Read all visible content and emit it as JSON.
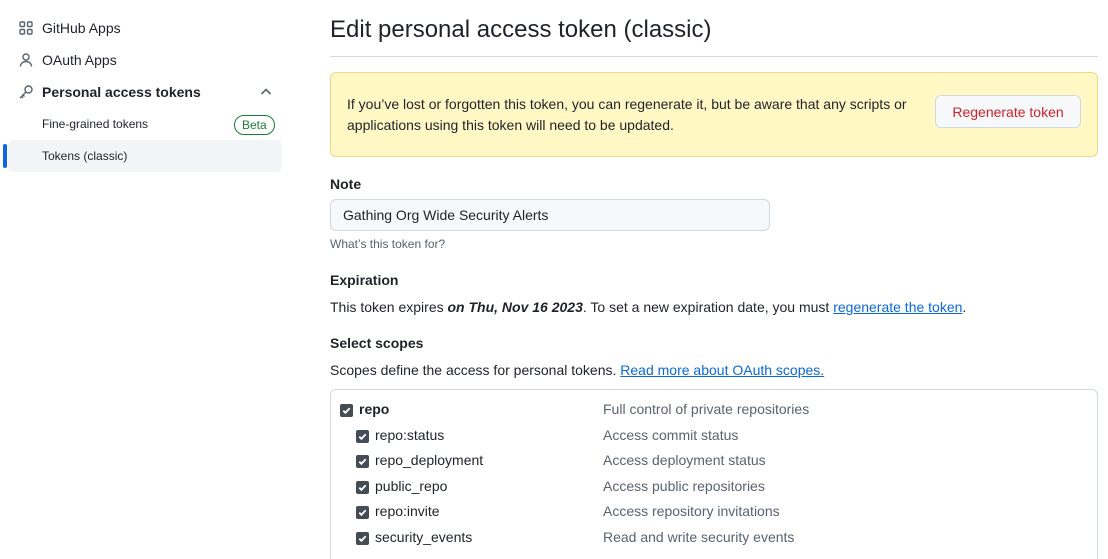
{
  "sidebar": {
    "items": [
      {
        "label": "GitHub Apps",
        "icon": "apps-grid-icon"
      },
      {
        "label": "OAuth Apps",
        "icon": "person-icon"
      },
      {
        "label": "Personal access tokens",
        "icon": "key-icon"
      }
    ],
    "sub_items": [
      {
        "label": "Fine-grained tokens",
        "badge": "Beta"
      },
      {
        "label": "Tokens (classic)",
        "selected": true
      }
    ]
  },
  "main": {
    "title": "Edit personal access token (classic)",
    "flash": {
      "message": "If you’ve lost or forgotten this token, you can regenerate it, but be aware that any scripts or applications using this token will need to be updated.",
      "button_label": "Regenerate token"
    },
    "note": {
      "label": "Note",
      "value": "Gathing Org Wide Security Alerts",
      "hint": "What’s this token for?"
    },
    "expiration": {
      "label": "Expiration",
      "prefix": "This token expires ",
      "date": "on Thu, Nov 16 2023",
      "middle": ". To set a new expiration date, you must ",
      "link": "regenerate the token",
      "suffix": "."
    },
    "scopes": {
      "label": "Select scopes",
      "intro": "Scopes define the access for personal tokens. ",
      "link": "Read more about OAuth scopes.",
      "rows": [
        {
          "name": "repo",
          "description": "Full control of private repositories",
          "checked": true,
          "parent": true
        },
        {
          "name": "repo:status",
          "description": "Access commit status",
          "checked": true
        },
        {
          "name": "repo_deployment",
          "description": "Access deployment status",
          "checked": true
        },
        {
          "name": "public_repo",
          "description": "Access public repositories",
          "checked": true
        },
        {
          "name": "repo:invite",
          "description": "Access repository invitations",
          "checked": true
        },
        {
          "name": "security_events",
          "description": "Read and write security events",
          "checked": true
        }
      ]
    }
  },
  "colors": {
    "accent": "#0969da",
    "danger": "#cf222e",
    "success": "#1a7f37",
    "flash_bg": "#fff8c5"
  }
}
